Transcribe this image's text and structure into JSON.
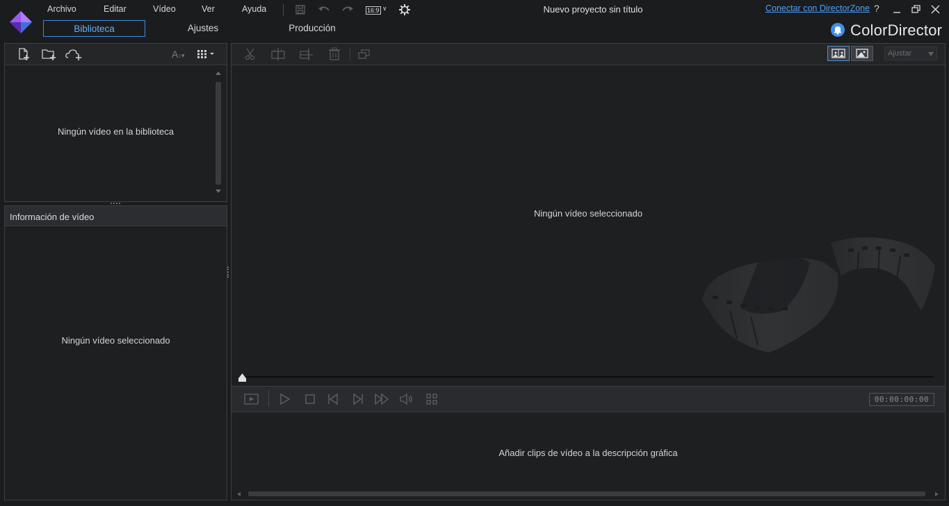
{
  "app": {
    "name": "ColorDirector",
    "project_title": "Nuevo proyecto sin título",
    "brand_color": "#5aa9ff"
  },
  "menu": {
    "items": [
      "Archivo",
      "Editar",
      "Vídeo",
      "Ver",
      "Ayuda"
    ],
    "aspect_ratio": "16:9"
  },
  "header": {
    "connect_link": "Conectar con DirectorZone",
    "help": "?"
  },
  "tabs": {
    "library": "Biblioteca",
    "settings": "Ajustes",
    "production": "Producción",
    "active": "Biblioteca"
  },
  "library": {
    "empty_text": "Ningún vídeo en la biblioteca",
    "font_size_btn": "A"
  },
  "video_info": {
    "header": "Información de vídeo",
    "empty_text": "Ningún vídeo seleccionado"
  },
  "preview": {
    "empty_text": "Ningún vídeo seleccionado",
    "fit_select": "Ajustar",
    "timecode": "00:00:00:00"
  },
  "storyboard": {
    "empty_text": "Añadir clips de vídeo a la descripción gráfica"
  }
}
